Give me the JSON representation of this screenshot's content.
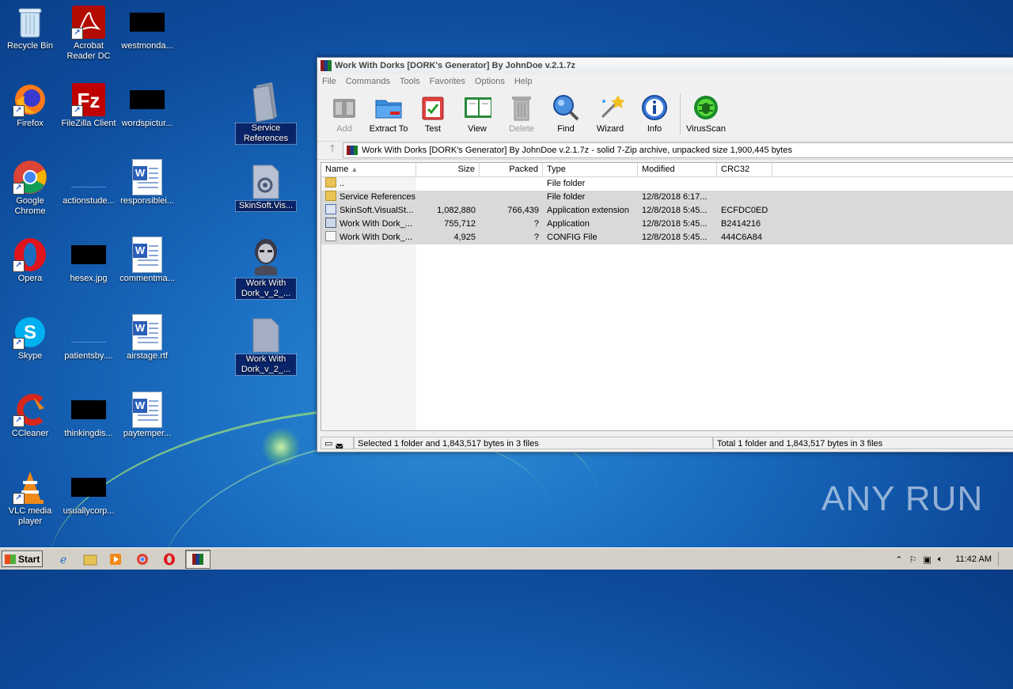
{
  "desktop": {
    "icons": [
      {
        "label": "Recycle Bin"
      },
      {
        "label": "Acrobat Reader DC"
      },
      {
        "label": "westmonda..."
      },
      {
        "label": "Firefox"
      },
      {
        "label": "FileZilla Client"
      },
      {
        "label": "wordspictur..."
      },
      {
        "label": "Service References"
      },
      {
        "label": "Google Chrome"
      },
      {
        "label": "actionstude..."
      },
      {
        "label": "responsiblei..."
      },
      {
        "label": "SkinSoft.Vis..."
      },
      {
        "label": "Opera"
      },
      {
        "label": "hesex.jpg"
      },
      {
        "label": "commentma..."
      },
      {
        "label": "Work With Dork_v_2_..."
      },
      {
        "label": "Skype"
      },
      {
        "label": "patientsby...."
      },
      {
        "label": "airstage.rtf"
      },
      {
        "label": "Work With Dork_v_2_..."
      },
      {
        "label": "CCleaner"
      },
      {
        "label": "thinkingdis..."
      },
      {
        "label": "paytemper..."
      },
      {
        "label": "VLC media player"
      },
      {
        "label": "usuallycorp..."
      }
    ]
  },
  "window": {
    "title": "Work With Dorks [DORK's Generator] By JohnDoe v.2.1.7z",
    "menu": [
      "File",
      "Commands",
      "Tools",
      "Favorites",
      "Options",
      "Help"
    ],
    "toolbar": [
      {
        "label": "Add",
        "icon": "add-archive-icon",
        "disabled": true
      },
      {
        "label": "Extract To",
        "icon": "extract-folder-icon",
        "disabled": false
      },
      {
        "label": "Test",
        "icon": "test-clipboard-icon",
        "disabled": false
      },
      {
        "label": "View",
        "icon": "view-book-icon",
        "disabled": false
      },
      {
        "label": "Delete",
        "icon": "trash-icon",
        "disabled": true
      },
      {
        "label": "Find",
        "icon": "magnifier-icon",
        "disabled": false
      },
      {
        "label": "Wizard",
        "icon": "wand-icon",
        "disabled": false
      },
      {
        "label": "Info",
        "icon": "info-icon",
        "disabled": false
      },
      {
        "label": "VirusScan",
        "icon": "bug-scan-icon",
        "disabled": false
      }
    ],
    "address": "Work With Dorks [DORK's Generator] By JohnDoe v.2.1.7z - solid 7-Zip archive, unpacked size 1,900,445 bytes",
    "columns": [
      "Name",
      "Size",
      "Packed",
      "Type",
      "Modified",
      "CRC32"
    ],
    "rows": [
      {
        "name": "..",
        "size": "",
        "packed": "",
        "type": "File folder",
        "modified": "",
        "crc": "",
        "icon": "folder",
        "selected": false
      },
      {
        "name": "Service References",
        "size": "",
        "packed": "",
        "type": "File folder",
        "modified": "12/8/2018 6:17...",
        "crc": "",
        "icon": "folder",
        "selected": true
      },
      {
        "name": "SkinSoft.VisualSt...",
        "size": "1,082,880",
        "packed": "766,439",
        "type": "Application extension",
        "modified": "12/8/2018 5:45...",
        "crc": "ECFDC0ED",
        "icon": "dll",
        "selected": true
      },
      {
        "name": "Work With Dork_...",
        "size": "755,712",
        "packed": "?",
        "type": "Application",
        "modified": "12/8/2018 5:45...",
        "crc": "B2414216",
        "icon": "exe",
        "selected": true
      },
      {
        "name": "Work With Dork_...",
        "size": "4,925",
        "packed": "?",
        "type": "CONFIG File",
        "modified": "12/8/2018 5:45...",
        "crc": "444C6A84",
        "icon": "cfg",
        "selected": true
      }
    ],
    "status_left": "Selected 1 folder and 1,843,517 bytes in 3 files",
    "status_right": "Total 1 folder and 1,843,517 bytes in 3 files"
  },
  "taskbar": {
    "start_label": "Start",
    "clock": "11:42 AM"
  },
  "watermark": "ANY RUN"
}
